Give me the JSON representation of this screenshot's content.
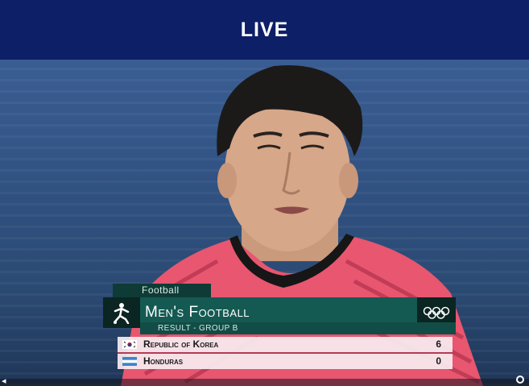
{
  "header": {
    "live_label": "LIVE"
  },
  "graphic": {
    "sport_label": "Football",
    "event_title": "Men's Football",
    "result_label": "RESULT - GROUP B",
    "teams": [
      {
        "name": "Republic of Korea",
        "score": "6",
        "flag": "korea-flag-icon"
      },
      {
        "name": "Honduras",
        "score": "0",
        "flag": "honduras-flag-icon"
      }
    ]
  },
  "icons": {
    "sport": "football-pictogram-icon",
    "rings": "olympic-rings-icon"
  },
  "colors": {
    "header_bg": "#0d1f66",
    "event_bar": "#155a52",
    "jersey_pink": "#e8546f"
  }
}
